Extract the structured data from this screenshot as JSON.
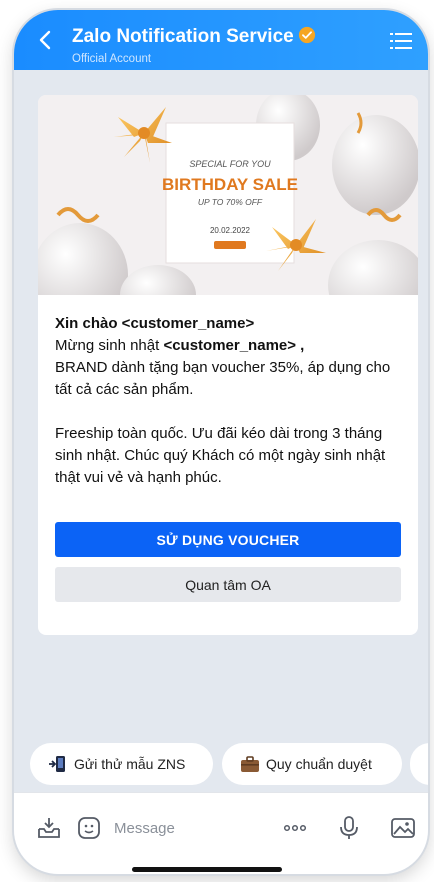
{
  "header": {
    "title": "Zalo Notification Service",
    "subtitle": "Official Account"
  },
  "banner": {
    "line1": "SPECIAL FOR YOU",
    "line2": "BIRTHDAY SALE",
    "line3": "UP TO 70% OFF",
    "date": "20.02.2022"
  },
  "message": {
    "greeting": "Xin chào <customer_name>",
    "line1_prefix": "Mừng sinh nhật ",
    "line1_name": "<customer_name> ,",
    "line2": "BRAND dành tặng bạn voucher 35%, áp dụng cho tất cả các sản phẩm.",
    "line3": "Freeship toàn quốc. Ưu đãi kéo dài trong 3 tháng sinh nhật. Chúc quý Khách có một ngày sinh nhật thật vui vẻ và hạnh phúc."
  },
  "buttons": {
    "primary": "SỬ DỤNG VOUCHER",
    "secondary": "Quan tâm OA"
  },
  "chips": [
    {
      "label": "Gửi thử mẫu ZNS",
      "icon": "phone-send-icon"
    },
    {
      "label": "Quy chuẩn duyệt",
      "icon": "briefcase-icon"
    }
  ],
  "input": {
    "placeholder": "Message"
  },
  "colors": {
    "header": "#1a8cff",
    "primary_button": "#0b63f6",
    "background": "#e3e8ef"
  }
}
